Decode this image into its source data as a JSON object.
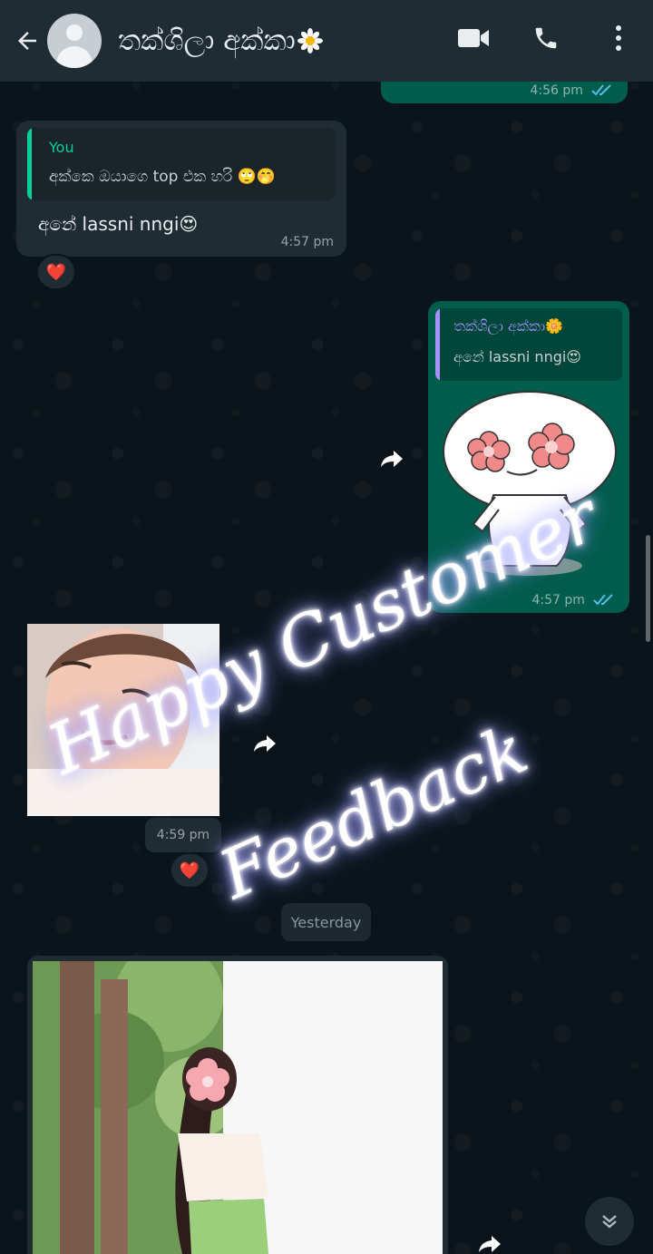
{
  "header": {
    "contact_name": "තක්ශිලා අක්කා",
    "back_icon": "arrow-back-icon",
    "video_icon": "video-call-icon",
    "call_icon": "phone-icon",
    "menu_icon": "more-vert-icon"
  },
  "messages": {
    "top_partial": {
      "time": "4:56 pm"
    },
    "msg1": {
      "quote_author": "You",
      "quote_text": "අක්කෙ ඔයාගෙ top එක හරි 🙄🤭",
      "text": "අනේ lassni nngi😍",
      "time": "4:57 pm",
      "reaction": "❤️"
    },
    "msg2": {
      "quote_author": "තක්ශිලා අක්කා🌼",
      "quote_text": "අනේ lassni nngi😍",
      "time": "4:57 pm"
    },
    "msg3": {
      "time": "4:59 pm",
      "reaction": "❤️"
    },
    "date_separator": "Yesterday"
  },
  "overlay": {
    "line1": "Happy Customer",
    "line2": "Feedback"
  },
  "colors": {
    "header_bg": "#1f2c34",
    "outgoing_bubble": "#005c4b",
    "incoming_bubble": "#202c33",
    "accent_green": "#00a884",
    "read_ticks": "#53bdeb"
  }
}
